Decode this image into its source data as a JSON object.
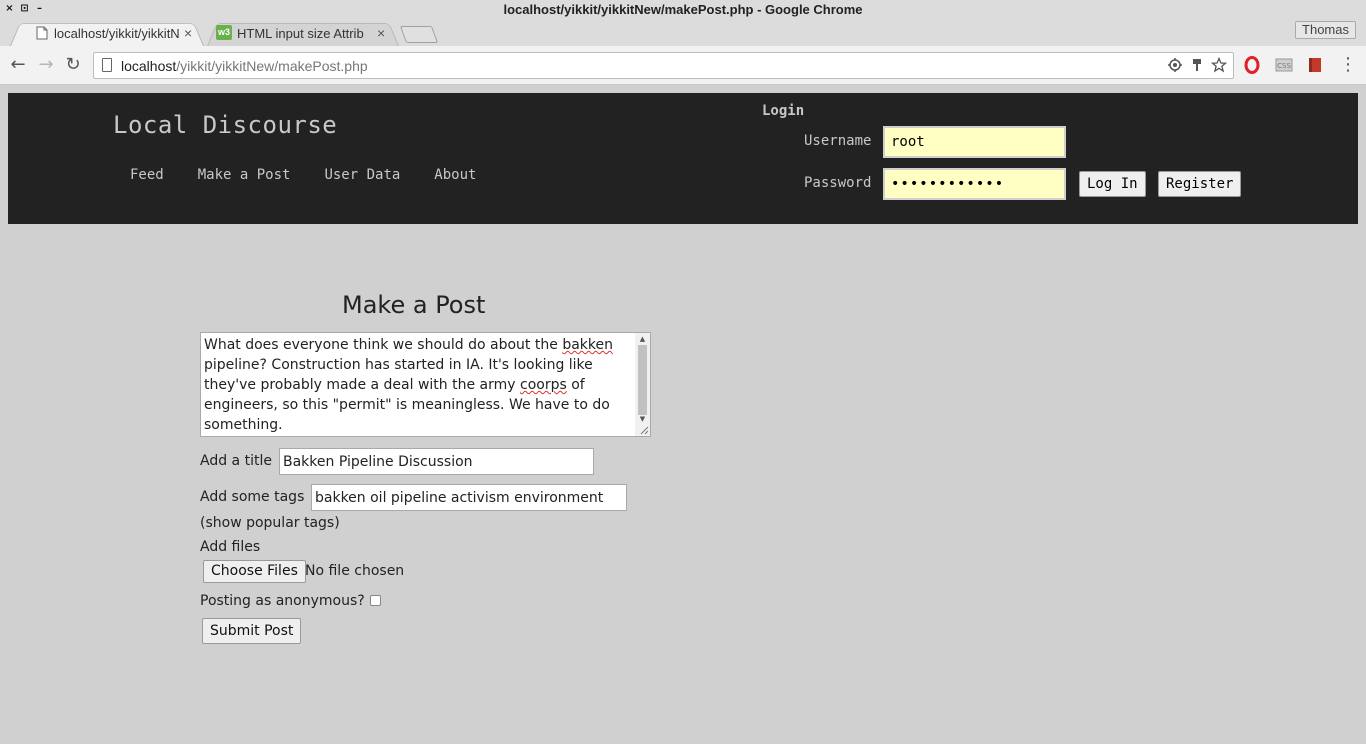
{
  "window": {
    "title": "localhost/yikkit/yikkitNew/makePost.php - Google Chrome",
    "controls": [
      "×",
      "⊡",
      "–"
    ]
  },
  "tabs": [
    {
      "title": "localhost/yikkit/yikkitN",
      "close": "×",
      "active": true
    },
    {
      "title": "HTML input size Attrib",
      "close": "×",
      "active": false
    }
  ],
  "profile": {
    "name": "Thomas"
  },
  "toolbar": {
    "back": "←",
    "forward": "→",
    "reload": "↻",
    "url_host": "localhost",
    "url_path": "/yikkit/yikkitNew/makePost.php"
  },
  "site": {
    "title": "Local Discourse",
    "nav": [
      "Feed",
      "Make a Post",
      "User Data",
      "About"
    ],
    "login": {
      "heading": "Login",
      "username_label": "Username",
      "username_value": "root",
      "password_label": "Password",
      "password_value": "••••••••••••",
      "login_button": "Log In",
      "register_button": "Register"
    }
  },
  "form": {
    "heading": "Make a Post",
    "body_text_parts": [
      "What does everyone think we should do about the ",
      "bakken",
      " pipeline? Construction has started in IA. It's looking like they've probably made a deal with the army ",
      "coorps",
      " of engineers, so this \"permit\" is meaningless. We have to do something."
    ],
    "title_label": "Add a title",
    "title_value": "Bakken Pipeline Discussion",
    "tags_label": "Add some tags",
    "tags_value": "bakken oil pipeline activism environment",
    "popular_tags_link": "(show popular tags)",
    "files_label": "Add files",
    "choose_files_button": "Choose Files",
    "no_file_text": "No file chosen",
    "anonymous_label": "Posting as anonymous?",
    "anonymous_checked": false,
    "submit_button": "Submit Post"
  }
}
